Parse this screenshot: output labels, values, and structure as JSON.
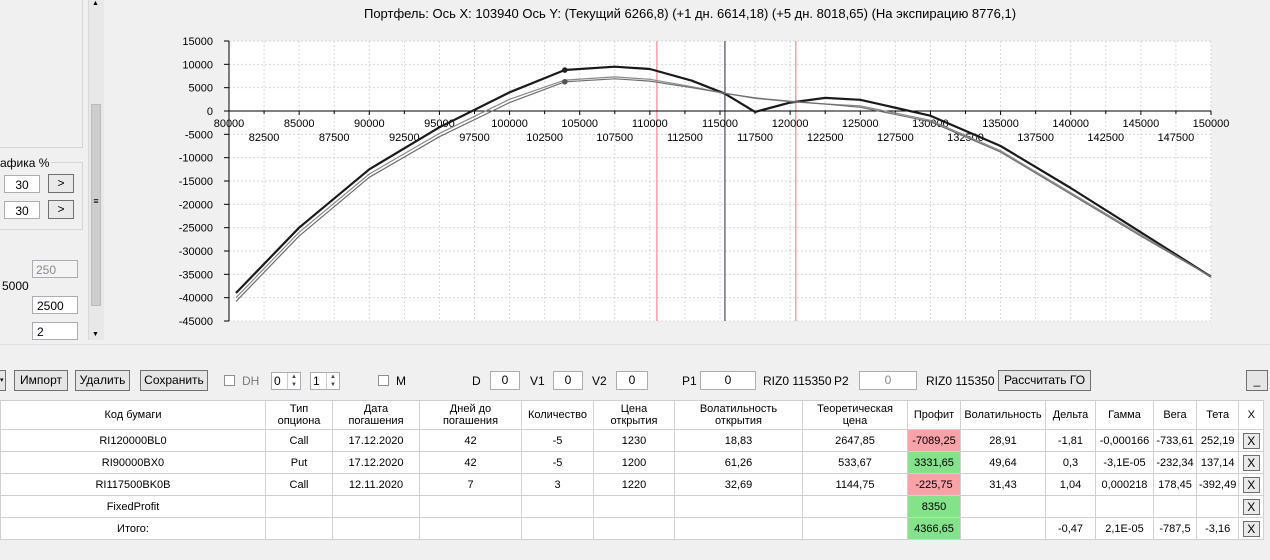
{
  "chart_title": "Портфель: Ось X: 103940 Ось Y:  (Текущий 6266,8)  (+1 дн. 6614,18)  (+5 дн. 8018,65)  (На экспирацию 8776,1)",
  "left_panel": {
    "group_label": "афика %",
    "field1": "30",
    "field2": "30",
    "arrow_label": ">",
    "field_disabled": "250",
    "label_5000": "5000",
    "field_2500": "2500",
    "field_2": "2",
    "scroll_grip": "≡"
  },
  "chart_data": {
    "type": "line",
    "x_ticks_upper": [
      80000,
      85000,
      90000,
      95000,
      100000,
      105000,
      110000,
      115000,
      120000,
      125000,
      130000,
      135000,
      140000,
      145000,
      150000
    ],
    "x_ticks_lower": [
      82500,
      87500,
      92500,
      97500,
      102500,
      107500,
      112500,
      117500,
      122500,
      127500,
      132500,
      137500,
      142500,
      147500
    ],
    "y_ticks": [
      15000,
      10000,
      5000,
      0,
      -5000,
      -10000,
      -15000,
      -20000,
      -25000,
      -30000,
      -35000,
      -40000,
      -45000
    ],
    "xlim": [
      80000,
      150000
    ],
    "ylim": [
      -45000,
      15000
    ],
    "cursor_x": 103940,
    "current_price_x": 115350,
    "red_lines_x": [
      110500,
      120400
    ],
    "series": [
      {
        "x": [
          80500,
          85000,
          90000,
          95000,
          100000,
          103940,
          107500,
          110000,
          113000,
          115350,
          117500,
          120000,
          122500,
          125000,
          130000,
          135000,
          140000,
          145000,
          150000
        ],
        "y": [
          -39000,
          -25000,
          -12500,
          -3500,
          4000,
          8776,
          9500,
          9000,
          6500,
          3700,
          -200,
          1800,
          2800,
          2400,
          -1000,
          -7500,
          -16500,
          -26000,
          -35500
        ]
      },
      {
        "x": [
          80500,
          85000,
          90000,
          95000,
          100000,
          103940,
          107500,
          110000,
          113000,
          115350,
          117500,
          120000,
          122500,
          125000,
          130000,
          135000,
          140000,
          145000,
          150000
        ],
        "y": [
          -40000,
          -26000,
          -13500,
          -4800,
          2500,
          6614,
          7300,
          6800,
          5200,
          3800,
          2700,
          2000,
          1500,
          1100,
          -2000,
          -8500,
          -17500,
          -26500,
          -35500
        ]
      },
      {
        "x": [
          80500,
          85000,
          90000,
          95000,
          100000,
          103940,
          107500,
          110000,
          113000,
          115350,
          117500,
          120000,
          122500,
          125000,
          130000,
          135000,
          140000,
          145000,
          150000
        ],
        "y": [
          -40800,
          -26800,
          -14200,
          -5500,
          1800,
          6267,
          6900,
          6400,
          5000,
          3800,
          2800,
          2100,
          1500,
          800,
          -2300,
          -8800,
          -17800,
          -26800,
          -35500
        ]
      }
    ],
    "markers": [
      {
        "x": 103940,
        "y": 8776
      },
      {
        "x": 103940,
        "y": 6267
      }
    ]
  },
  "toolbar": {
    "import": "Импорт",
    "delete": "Удалить",
    "save": "Сохранить",
    "dh": "DH",
    "spin1": "0",
    "spin2": "1",
    "m": "M",
    "d_label": "D",
    "d_value": "0",
    "v1_label": "V1",
    "v1_value": "0",
    "v2_label": "V2",
    "v2_value": "0",
    "p1_label": "P1",
    "p1_value": "0",
    "riz_1": "RIZ0 115350",
    "p2_label": "P2",
    "p2_value": "0",
    "riz_2": "RIZ0 115350",
    "calc_go": "Рассчитать ГО",
    "minimize": "_"
  },
  "table": {
    "headers": [
      "Код бумаги",
      "Тип опциона",
      "Дата погашения",
      "Дней до погашения",
      "Количество",
      "Цена открытия",
      "Волатильность открытия",
      "Теоретическая цена",
      "Профит",
      "Волатильность",
      "Дельта",
      "Гамма",
      "Вега",
      "Тета",
      "X"
    ],
    "rows": [
      [
        "RI120000BL0",
        "Call",
        "17.12.2020",
        "42",
        "-5",
        "1230",
        "18,83",
        "2647,85",
        "-7089,25",
        "28,91",
        "-1,81",
        "-0,000166",
        "-733,61",
        "252,19",
        "X"
      ],
      [
        "RI90000BX0",
        "Put",
        "17.12.2020",
        "42",
        "-5",
        "1200",
        "61,26",
        "533,67",
        "3331,65",
        "49,64",
        "0,3",
        "-3,1E-05",
        "-232,34",
        "137,14",
        "X"
      ],
      [
        "RI117500BK0B",
        "Call",
        "12.11.2020",
        "7",
        "3",
        "1220",
        "32,69",
        "1144,75",
        "-225,75",
        "31,43",
        "1,04",
        "0,000218",
        "178,45",
        "-392,49",
        "X"
      ],
      [
        "FixedProfit",
        "",
        "",
        "",
        "",
        "",
        "",
        "",
        "8350",
        "",
        "",
        "",
        "",
        "",
        "X"
      ],
      [
        "Итого:",
        "",
        "",
        "",
        "",
        "",
        "",
        "",
        "4366,65",
        "",
        "-0,47",
        "2,1E-05",
        "-787,5",
        "-3,16",
        "X"
      ]
    ],
    "profit_colors": {
      "negative": "#f7a1a8",
      "positive": "#84e28a"
    }
  }
}
